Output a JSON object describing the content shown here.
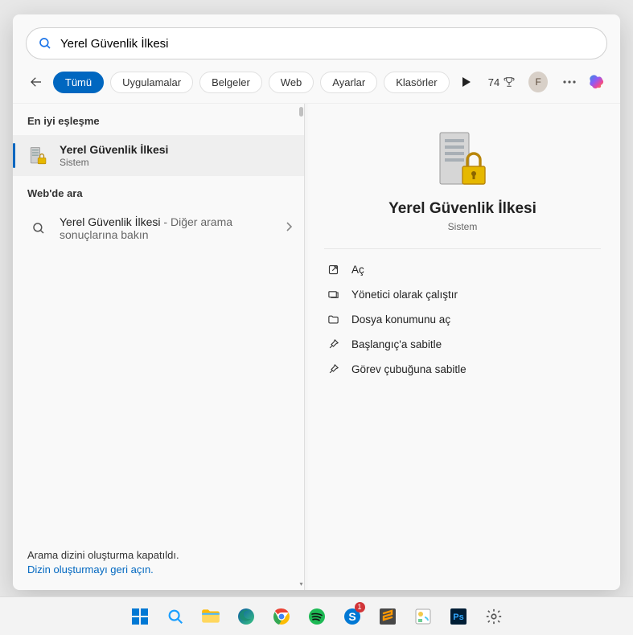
{
  "search": {
    "query": "Yerel Güvenlik İlkesi"
  },
  "filters": {
    "all": "Tümü",
    "apps": "Uygulamalar",
    "docs": "Belgeler",
    "web": "Web",
    "settings": "Ayarlar",
    "folders": "Klasörler"
  },
  "header": {
    "points": "74",
    "avatar_letter": "F"
  },
  "left": {
    "best_match": "En iyi eşleşme",
    "result_title": "Yerel Güvenlik İlkesi",
    "result_sub": "Sistem",
    "web_search": "Web'de ara",
    "web_item_main": "Yerel Güvenlik İlkesi",
    "web_item_tail": " - Diğer arama sonuçlarına bakın",
    "index_off": "Arama dizini oluşturma kapatıldı.",
    "index_link": "Dizin oluşturmayı geri açın."
  },
  "preview": {
    "title": "Yerel Güvenlik İlkesi",
    "sub": "Sistem",
    "actions": {
      "open": "Aç",
      "admin": "Yönetici olarak çalıştır",
      "fileloc": "Dosya konumunu aç",
      "pinstart": "Başlangıç'a sabitle",
      "pintask": "Görev çubuğuna sabitle"
    }
  },
  "taskbar": {
    "skype_badge": "1"
  }
}
